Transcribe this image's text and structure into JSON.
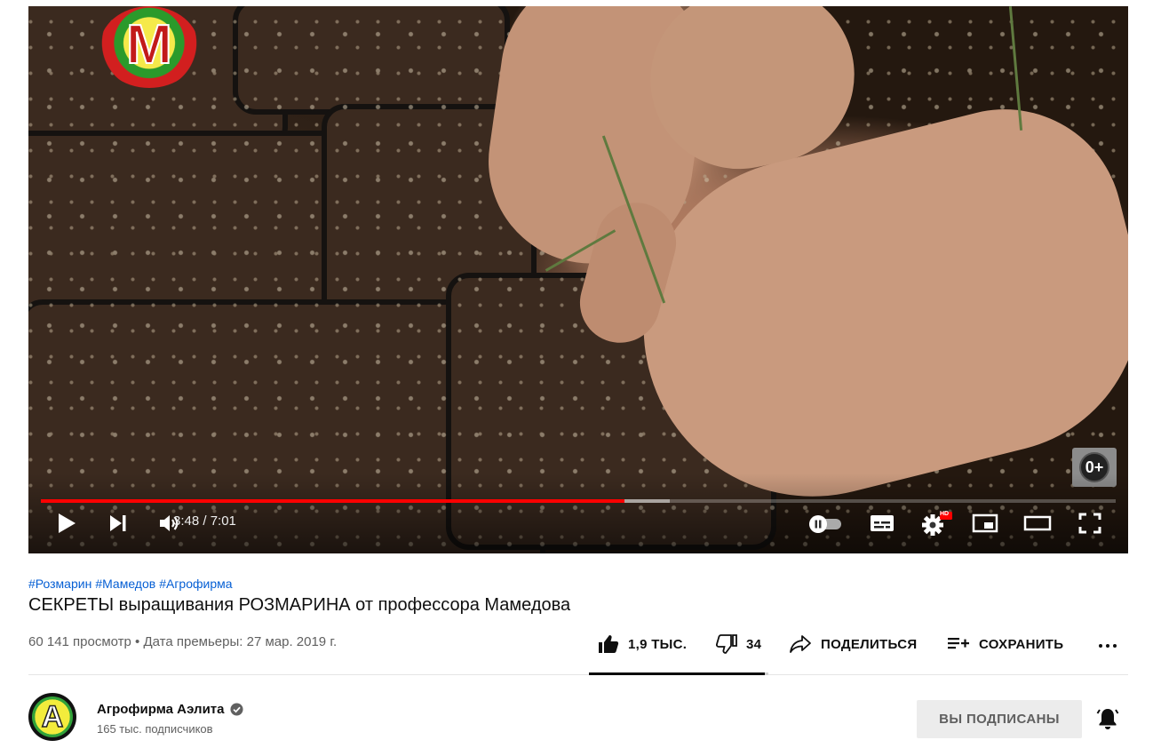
{
  "player": {
    "current_time": "3:48",
    "duration": "7:01",
    "time_display": "3:48 / 7:01",
    "progress_fraction": 0.543,
    "buffered_fraction": 0.585,
    "watermark_logo_letter": "M",
    "age_rating": "0+",
    "settings_badge": "HD",
    "colors": {
      "progress": "#ff0000"
    },
    "controls": {
      "play": "play-icon",
      "next": "next-icon",
      "volume": "volume-icon",
      "autoplay": "autoplay-toggle-icon",
      "subtitles": "subtitles-icon",
      "settings": "gear-icon",
      "miniplayer": "miniplayer-icon",
      "theater": "theater-mode-icon",
      "fullscreen": "fullscreen-icon"
    }
  },
  "video": {
    "hashtags": [
      "#Розмарин",
      "#Мамедов",
      "#Агрофирма"
    ],
    "title": "СЕКРЕТЫ выращивания РОЗМАРИНА от профессора Мамедова",
    "meta": "60 141 просмотр • Дата премьеры: 27 мар. 2019 г."
  },
  "actions": {
    "likes": "1,9 ТЫС.",
    "dislikes": "34",
    "share": "ПОДЕЛИТЬСЯ",
    "save": "СОХРАНИТЬ",
    "more": "more-icon",
    "like_ratio": 0.98
  },
  "channel": {
    "name": "Агрофирма Аэлита",
    "subscribers": "165 тыс. подписчиков",
    "avatar_letter": "A",
    "verified": "verified-icon",
    "subscribe_state": "ВЫ ПОДПИСАНЫ",
    "notification": "bell-icon"
  }
}
